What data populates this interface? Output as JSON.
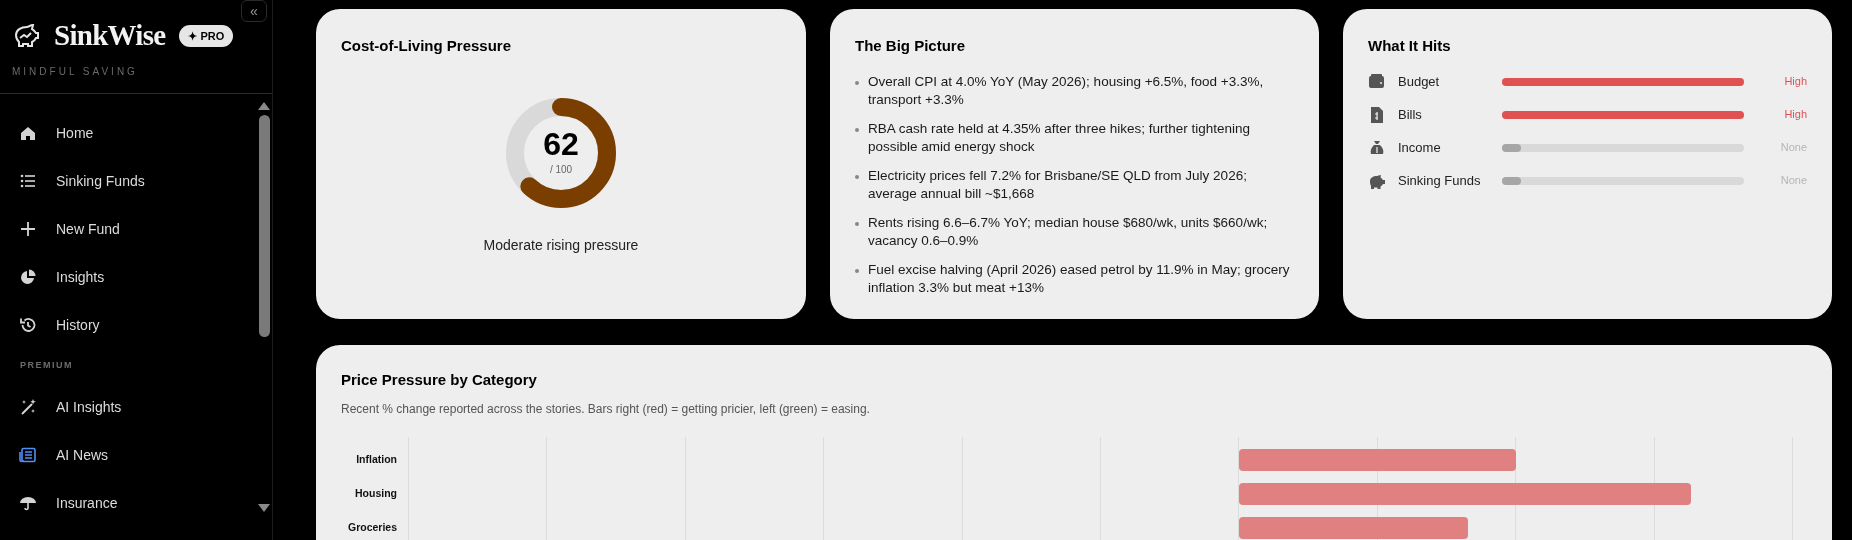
{
  "sidebar": {
    "brand": "SinkWise",
    "badge": "✦ PRO",
    "tagline": "MINDFUL SAVING",
    "collapse": "«",
    "items": [
      "Home",
      "Sinking Funds",
      "New Fund",
      "Insights",
      "History"
    ],
    "section_label": "PREMIUM",
    "premium_items": [
      "AI Insights",
      "AI News",
      "Insurance"
    ]
  },
  "pressure_card": {
    "title": "Cost-of-Living Pressure",
    "score": "62",
    "scale": "/ 100",
    "level": 0.62,
    "summary": "Moderate rising pressure"
  },
  "big_picture": {
    "title": "The Big Picture",
    "bullets": [
      "Overall CPI at 4.0% YoY (May 2026); housing +6.5%, food +3.3%, transport +3.3%",
      "RBA cash rate held at 4.35% after three hikes; further tightening possible amid energy shock",
      "Electricity prices fell 7.2% for Brisbane/SE QLD from July 2026; average annual bill ~$1,668",
      "Rents rising 6.6–6.7% YoY; median house $680/wk, units $660/wk; vacancy 0.6–0.9%",
      "Fuel excise halving (April 2026) eased petrol by 11.9% in May; grocery inflation 3.3% but meat +13%"
    ]
  },
  "what_it_hits": {
    "title": "What It Hits",
    "rows": [
      {
        "label": "Budget",
        "kind": "high",
        "level": 1,
        "rating": "High"
      },
      {
        "label": "Bills",
        "kind": "high",
        "level": 1,
        "rating": "High"
      },
      {
        "label": "Income",
        "kind": "none",
        "level": 0.08,
        "rating": "None"
      },
      {
        "label": "Sinking Funds",
        "kind": "none",
        "level": 0.08,
        "rating": "None"
      }
    ]
  },
  "price_pressure": {
    "title": "Price Pressure by Category",
    "subtitle": "Recent % change reported across the stories. Bars right (red) = getting pricier, left (green) = easing.",
    "rows": [
      "Inflation",
      "Housing",
      "Groceries"
    ]
  }
}
